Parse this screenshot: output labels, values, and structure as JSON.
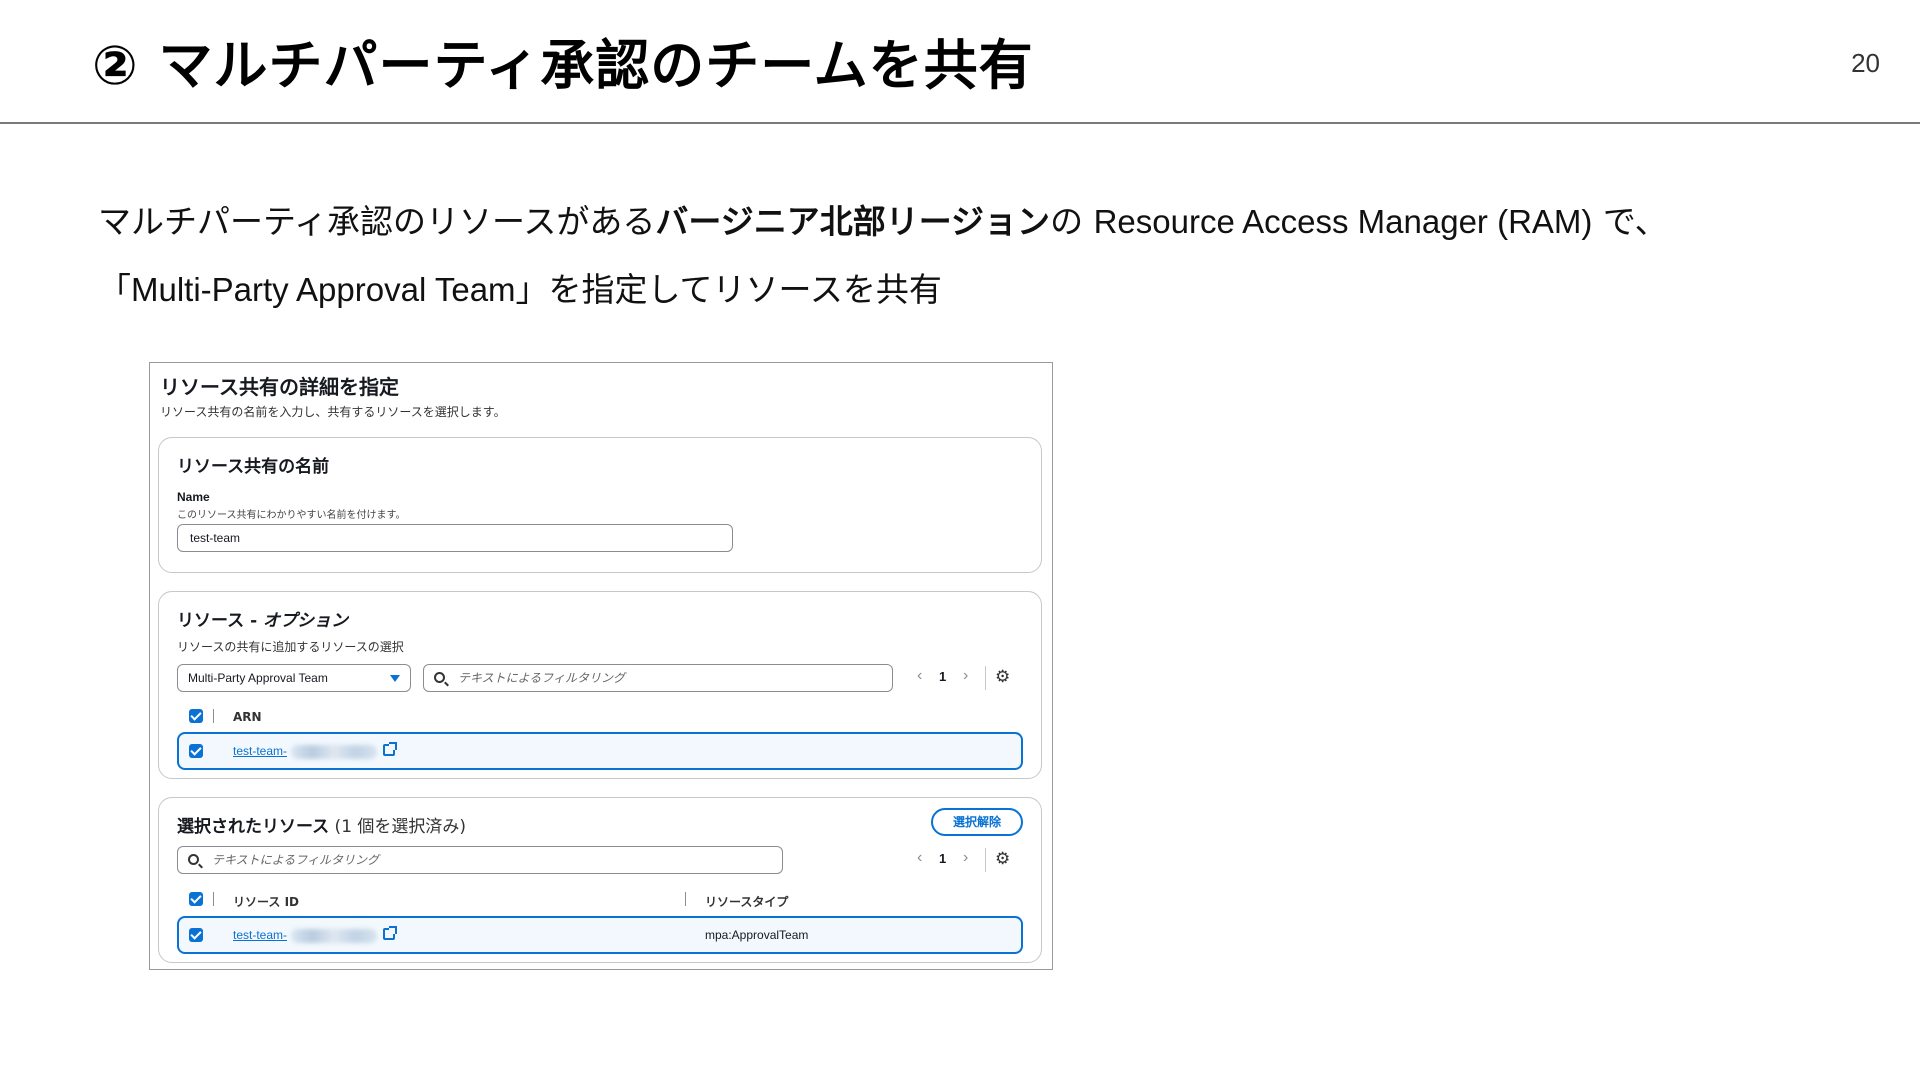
{
  "slide": {
    "title": "② マルチパーティ承認のチームを共有",
    "page_number": "20",
    "desc_line1_part1": "マルチパーティ承認のリソースがある",
    "desc_line1_bold": "バージニア北部リージョン",
    "desc_line1_part2": "の ",
    "desc_line1_en": "Resource Access Manager (RAM)",
    "desc_line1_part3": " で、",
    "desc_line2_open": "「",
    "desc_line2_en": "Multi-Party Approval Team",
    "desc_line2_close": "」を指定してリソースを共有"
  },
  "screenshot": {
    "heading": "リソース共有の詳細を指定",
    "subheading": "リソース共有の名前を入力し、共有するリソースを選択します。",
    "name_card": {
      "title": "リソース共有の名前",
      "field_label": "Name",
      "field_hint": "このリソース共有にわかりやすい名前を付けます。",
      "value": "test-team"
    },
    "resources_card": {
      "title_plain": "リソース - ",
      "title_italic": "オプション",
      "description": "リソースの共有に追加するリソースの選択",
      "type_select": "Multi-Party Approval Team",
      "filter_placeholder": "テキストによるフィルタリング",
      "page": "1",
      "column_arn": "ARN",
      "row_link": "test-team-"
    },
    "selected_card": {
      "title_bold": "選択されたリソース",
      "title_count": " (1 個を選択済み)",
      "deselect_button": "選択解除",
      "filter_placeholder": "テキストによるフィルタリング",
      "page": "1",
      "column_id": "リソース ID",
      "column_type": "リソースタイプ",
      "row_link": "test-team-",
      "row_type": "mpa:ApprovalTeam"
    }
  },
  "icons": {
    "prev": "‹",
    "next": "›",
    "gear": "⚙"
  },
  "colors": {
    "accent": "#0972d3"
  }
}
